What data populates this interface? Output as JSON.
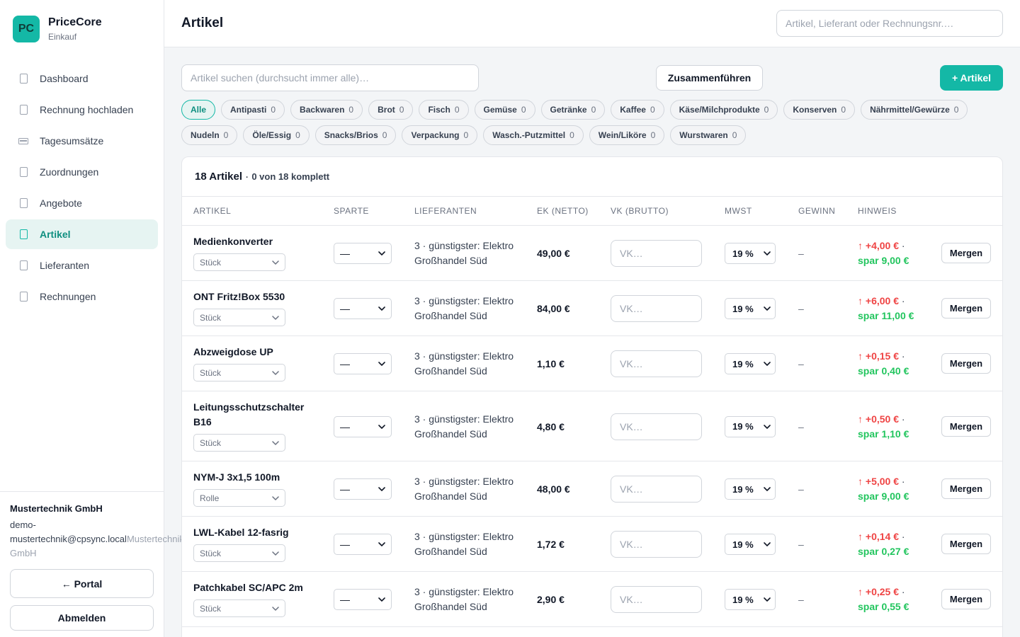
{
  "brand": {
    "logo": "PC",
    "name": "PriceCore",
    "sub": "Einkauf"
  },
  "nav": [
    {
      "label": "Dashboard",
      "icon": "dashboard-icon",
      "active": false
    },
    {
      "label": "Rechnung hochladen",
      "icon": "upload-icon",
      "active": false
    },
    {
      "label": "Tagesumsätze",
      "icon": "register-icon",
      "active": false
    },
    {
      "label": "Zuordnungen",
      "icon": "link-icon",
      "active": false
    },
    {
      "label": "Angebote",
      "icon": "offer-icon",
      "active": false
    },
    {
      "label": "Artikel",
      "icon": "article-icon",
      "active": true
    },
    {
      "label": "Lieferanten",
      "icon": "supplier-icon",
      "active": false
    },
    {
      "label": "Rechnungen",
      "icon": "invoice-icon",
      "active": false
    }
  ],
  "account": {
    "org": "Mustertechnik GmbH",
    "email": "demo-mustertechnik@cpsync.local",
    "org_repeat": "Mustertechnik GmbH",
    "portal_label": "← Portal",
    "logout_label": "Abmelden"
  },
  "header": {
    "title": "Artikel",
    "search_placeholder": "Artikel, Lieferant oder Rechnungsnr.…"
  },
  "toolbar": {
    "search_placeholder": "Artikel suchen (durchsucht immer alle)…",
    "merge_label": "Zusammenführen",
    "add_label": "+ Artikel"
  },
  "chips": [
    [
      {
        "label": "Alle",
        "count": "",
        "active": true
      },
      {
        "label": "Antipasti",
        "count": "0"
      },
      {
        "label": "Backwaren",
        "count": "0"
      },
      {
        "label": "Brot",
        "count": "0"
      },
      {
        "label": "Fisch",
        "count": "0"
      },
      {
        "label": "Gemüse",
        "count": "0"
      },
      {
        "label": "Getränke",
        "count": "0"
      },
      {
        "label": "Kaffee",
        "count": "0"
      },
      {
        "label": "Käse/Milchprodukte",
        "count": "0"
      },
      {
        "label": "Konserven",
        "count": "0"
      },
      {
        "label": "Nährmittel/Gewürze",
        "count": "0"
      }
    ],
    [
      {
        "label": "Nudeln",
        "count": "0"
      },
      {
        "label": "Öle/Essig",
        "count": "0"
      },
      {
        "label": "Snacks/Brios",
        "count": "0"
      },
      {
        "label": "Verpackung",
        "count": "0"
      },
      {
        "label": "Wasch.-Putzmittel",
        "count": "0"
      },
      {
        "label": "Wein/Liköre",
        "count": "0"
      },
      {
        "label": "Wurstwaren",
        "count": "0"
      }
    ]
  ],
  "table": {
    "count_label": "18 Artikel",
    "separator": " · ",
    "complete_label": "0 von 18 komplett",
    "columns": [
      "ARTIKEL",
      "SPARTE",
      "LIEFERANTEN",
      "EK (NETTO)",
      "VK (BRUTTO)",
      "MWST",
      "GEWINN",
      "HINWEIS"
    ],
    "vk_placeholder": "VK…",
    "merge_row_label": "Mergen",
    "rows": [
      {
        "name": "Medienkonverter",
        "unit": "Stück",
        "sparte": "—",
        "suppliers": "3 · günstigster: Elektro Großhandel Süd",
        "ek": "49,00 €",
        "mwst": "19 %",
        "gewinn": "–",
        "hint_up": "↑ +4,00 €",
        "hint_save": "spar 9,00 €"
      },
      {
        "name": "ONT Fritz!Box 5530",
        "unit": "Stück",
        "sparte": "—",
        "suppliers": "3 · günstigster: Elektro Großhandel Süd",
        "ek": "84,00 €",
        "mwst": "19 %",
        "gewinn": "–",
        "hint_up": "↑ +6,00 €",
        "hint_save": "spar 11,00 €"
      },
      {
        "name": "Abzweigdose UP",
        "unit": "Stück",
        "sparte": "—",
        "suppliers": "3 · günstigster: Elektro Großhandel Süd",
        "ek": "1,10 €",
        "mwst": "19 %",
        "gewinn": "–",
        "hint_up": "↑ +0,15 €",
        "hint_save": "spar 0,40 €"
      },
      {
        "name": "Leitungsschutzschalter B16",
        "unit": "Stück",
        "sparte": "—",
        "suppliers": "3 · günstigster: Elektro Großhandel Süd",
        "ek": "4,80 €",
        "mwst": "19 %",
        "gewinn": "–",
        "hint_up": "↑ +0,50 €",
        "hint_save": "spar 1,10 €"
      },
      {
        "name": "NYM-J 3x1,5 100m",
        "unit": "Rolle",
        "sparte": "—",
        "suppliers": "3 · günstigster: Elektro Großhandel Süd",
        "ek": "48,00 €",
        "mwst": "19 %",
        "gewinn": "–",
        "hint_up": "↑ +5,00 €",
        "hint_save": "spar 9,00 €"
      },
      {
        "name": "LWL-Kabel 12-fasrig",
        "unit": "Stück",
        "sparte": "—",
        "suppliers": "3 · günstigster: Elektro Großhandel Süd",
        "ek": "1,72 €",
        "mwst": "19 %",
        "gewinn": "–",
        "hint_up": "↑ +0,14 €",
        "hint_save": "spar 0,27 €"
      },
      {
        "name": "Patchkabel SC/APC 2m",
        "unit": "Stück",
        "sparte": "—",
        "suppliers": "3 · günstigster: Elektro Großhandel Süd",
        "ek": "2,90 €",
        "mwst": "19 %",
        "gewinn": "–",
        "hint_up": "↑ +0,25 €",
        "hint_save": "spar 0,55 €"
      }
    ]
  },
  "colors": {
    "accent": "#14b8a6",
    "accent_bg": "#e6f4f2",
    "up": "#ef4444",
    "save": "#22c55e"
  }
}
